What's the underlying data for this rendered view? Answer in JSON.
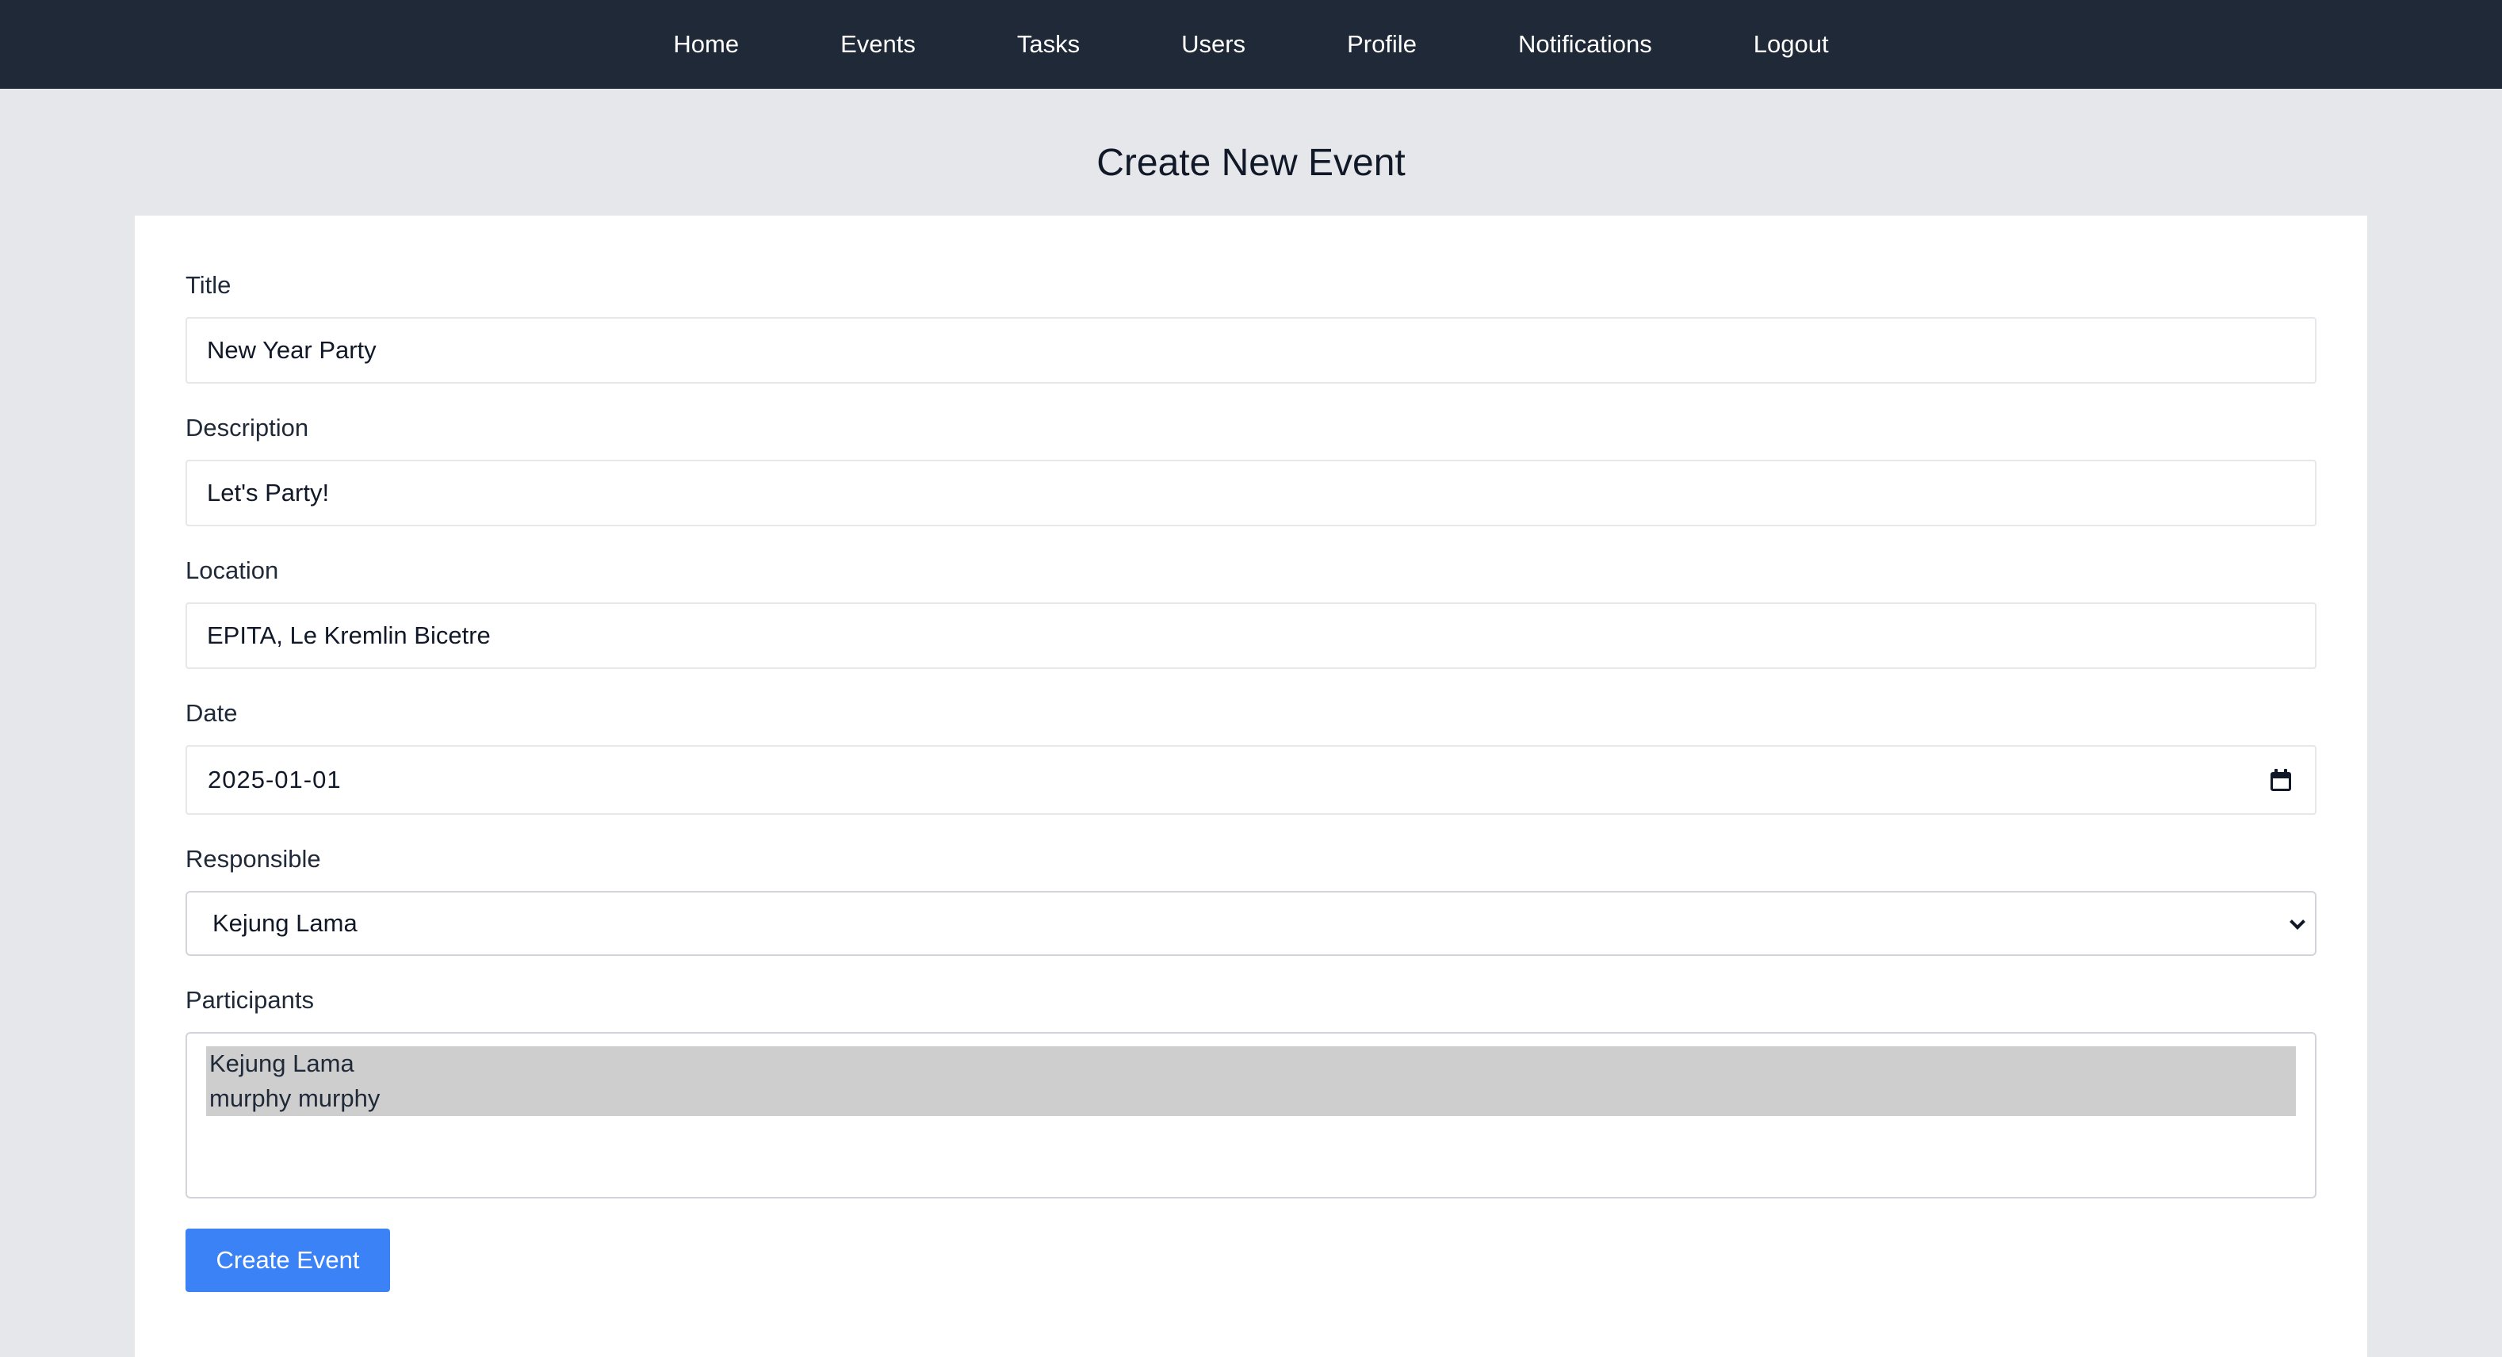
{
  "nav": {
    "items": [
      {
        "label": "Home"
      },
      {
        "label": "Events"
      },
      {
        "label": "Tasks"
      },
      {
        "label": "Users"
      },
      {
        "label": "Profile"
      },
      {
        "label": "Notifications"
      },
      {
        "label": "Logout"
      }
    ]
  },
  "page": {
    "title": "Create New Event"
  },
  "form": {
    "title": {
      "label": "Title",
      "value": "New Year Party"
    },
    "description": {
      "label": "Description",
      "value": "Let's Party!"
    },
    "location": {
      "label": "Location",
      "value": "EPITA, Le Kremlin Bicetre"
    },
    "date": {
      "label": "Date",
      "value": "2025-01-01",
      "icon": "calendar-icon"
    },
    "responsible": {
      "label": "Responsible",
      "selected": "Kejung Lama",
      "icon": "chevron-down-icon"
    },
    "participants": {
      "label": "Participants",
      "options": [
        {
          "label": "Kejung Lama",
          "selected": true
        },
        {
          "label": "murphy murphy",
          "selected": true
        }
      ]
    },
    "submit_label": "Create Event"
  },
  "colors": {
    "navbar_bg": "#1f2937",
    "page_bg": "#e5e7eb",
    "button_bg": "#3b82f6",
    "selected_option_bg": "#cecece"
  }
}
